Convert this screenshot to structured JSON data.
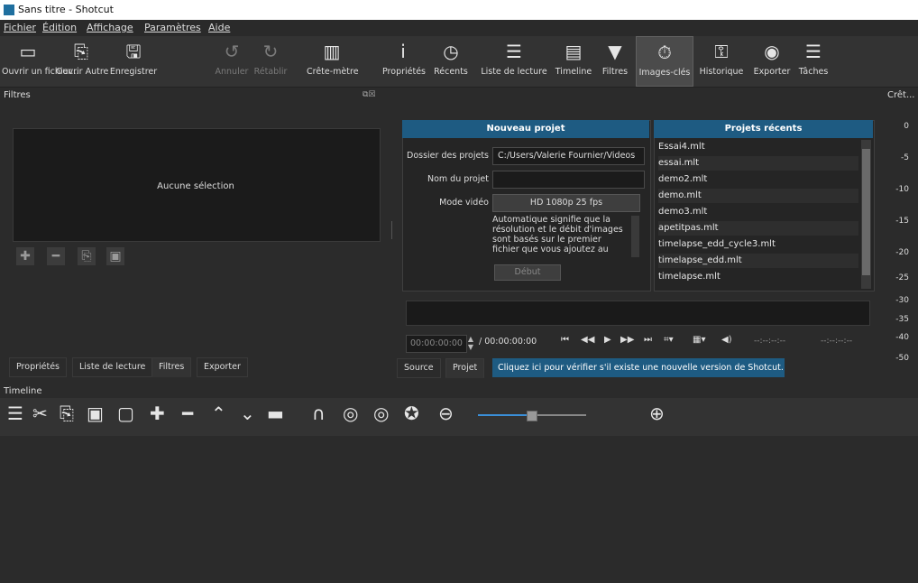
{
  "window": {
    "title": "Sans titre - Shotcut"
  },
  "menu": [
    "Fichier",
    "Édition",
    "Affichage",
    "Paramètres",
    "Aide"
  ],
  "toolbar": [
    {
      "icon": "folder-icon",
      "label": "Ouvrir un fichier..."
    },
    {
      "icon": "open-other-icon",
      "label": "Ouvrir Autre"
    },
    {
      "icon": "save-icon",
      "label": "Enregistrer"
    },
    {
      "icon": "undo-icon",
      "label": "Annuler"
    },
    {
      "icon": "redo-icon",
      "label": "Rétablir"
    },
    {
      "icon": "peak-meter-icon",
      "label": "Crête-mètre"
    },
    {
      "icon": "info-icon",
      "label": "Propriétés"
    },
    {
      "icon": "clock-icon",
      "label": "Récents"
    },
    {
      "icon": "playlist-icon",
      "label": "Liste de lecture"
    },
    {
      "icon": "timeline-icon",
      "label": "Timeline"
    },
    {
      "icon": "filter-icon",
      "label": "Filtres"
    },
    {
      "icon": "stopwatch-icon",
      "label": "Images-clés"
    },
    {
      "icon": "history-icon",
      "label": "Historique"
    },
    {
      "icon": "export-icon",
      "label": "Exporter"
    },
    {
      "icon": "jobs-icon",
      "label": "Tâches"
    }
  ],
  "filters": {
    "title": "Filtres",
    "empty_text": "Aucune sélection"
  },
  "new_project": {
    "title": "Nouveau projet",
    "folder_label": "Dossier des projets",
    "folder_value": "C:/Users/Valerie Fournier/Videos",
    "name_label": "Nom du projet",
    "name_value": "",
    "video_mode_label": "Mode vidéo",
    "video_mode_value": "HD 1080p 25 fps",
    "info_line1": "Automatique signifie que la",
    "info_line2": "résolution et le débit d'images",
    "info_line3": "sont basés sur le premier",
    "info_line4": "fichier que vous ajoutez au",
    "start_button": "Début"
  },
  "recent_projects": {
    "title": "Projets récents",
    "items": [
      "Essai4.mlt",
      "essai.mlt",
      "demo2.mlt",
      "demo.mlt",
      "demo3.mlt",
      "apetitpas.mlt",
      "timelapse_edd_cycle3.mlt",
      "timelapse_edd.mlt",
      "timelapse.mlt"
    ]
  },
  "audio_meter": {
    "label": "Crêt...",
    "ticks": [
      "0",
      "-5",
      "-10",
      "-15",
      "-20",
      "-25",
      "-30",
      "-35",
      "-40",
      "-50"
    ]
  },
  "player": {
    "timecode": "00:00:00:00",
    "duration": "/ 00:00:00:00",
    "in_point": "--:--:--:--",
    "out_point": "--:--:--:--"
  },
  "left_tabs": [
    "Propriétés",
    "Liste de lecture",
    "Filtres",
    "Exporter"
  ],
  "source_tabs": [
    "Source",
    "Projet"
  ],
  "notice": "Cliquez ici pour vérifier s'il existe une nouvelle version de Shotcut.",
  "timeline": {
    "title": "Timeline"
  }
}
